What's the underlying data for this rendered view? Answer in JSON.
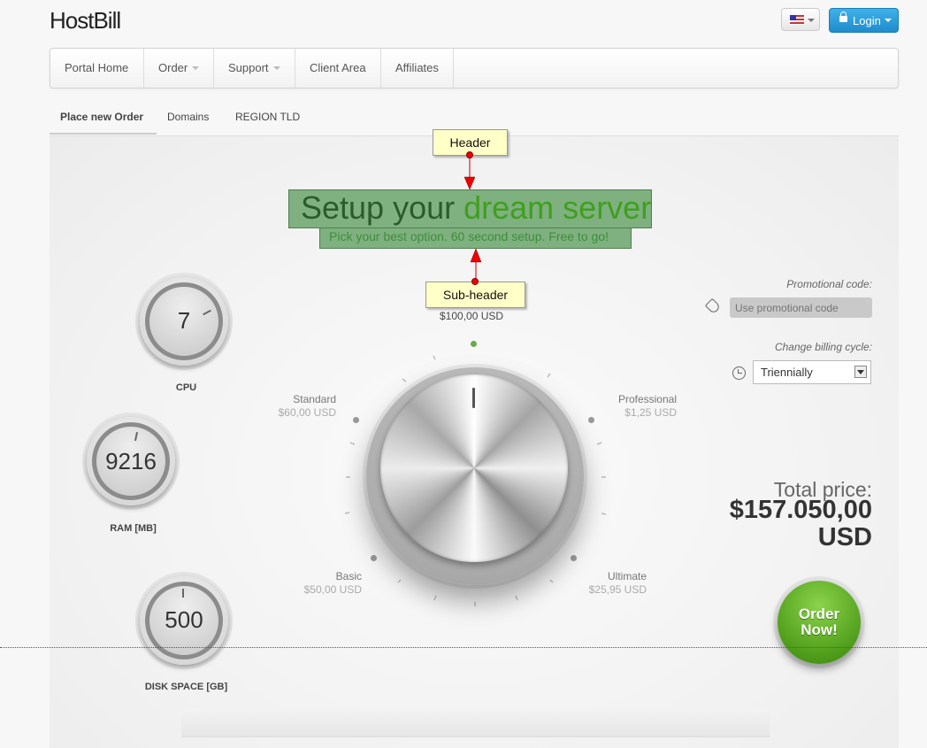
{
  "header": {
    "logo": "HostBill",
    "language_icon": "us-flag-icon",
    "login_label": "Login"
  },
  "nav": {
    "items": [
      {
        "label": "Portal Home",
        "dropdown": false
      },
      {
        "label": "Order",
        "dropdown": true
      },
      {
        "label": "Support",
        "dropdown": true
      },
      {
        "label": "Client Area",
        "dropdown": false
      },
      {
        "label": "Affiliates",
        "dropdown": false
      }
    ]
  },
  "tabs": {
    "items": [
      {
        "label": "Place new Order",
        "active": true
      },
      {
        "label": "Domains",
        "active": false
      },
      {
        "label": "REGION TLD",
        "active": false
      }
    ]
  },
  "annotations": {
    "header_callout": "Header",
    "subheader_callout": "Sub-header"
  },
  "hero": {
    "title_part1": "Setup your ",
    "title_part2": "dream server",
    "subtitle": "Pick your best option. 60 second setup. Free to go!"
  },
  "selected_price": "$100,00 USD",
  "plans": [
    {
      "name": "Standard",
      "price": "$60,00 USD"
    },
    {
      "name": "Professional",
      "price": "$1,25 USD"
    },
    {
      "name": "Basic",
      "price": "$50,00 USD"
    },
    {
      "name": "Ultimate",
      "price": "$25,95 USD"
    }
  ],
  "gauges": [
    {
      "value": "7",
      "label": "CPU"
    },
    {
      "value": "9216",
      "label": "RAM [MB]"
    },
    {
      "value": "500",
      "label": "DISK SPACE [GB]"
    }
  ],
  "promo": {
    "label": "Promotional code:",
    "placeholder": "Use promotional code"
  },
  "billing": {
    "label": "Change billing cycle:",
    "selected": "Triennially"
  },
  "total": {
    "label": "Total price:",
    "amount_line1": "$157.050,00",
    "amount_line2": "USD"
  },
  "order_button": {
    "line1": "Order",
    "line2": "Now!"
  },
  "colors": {
    "accent_green": "#4f9d1a",
    "login_blue": "#1f8ccc",
    "annotation_yellow": "#ffffc8",
    "annotation_red": "#e00000"
  }
}
